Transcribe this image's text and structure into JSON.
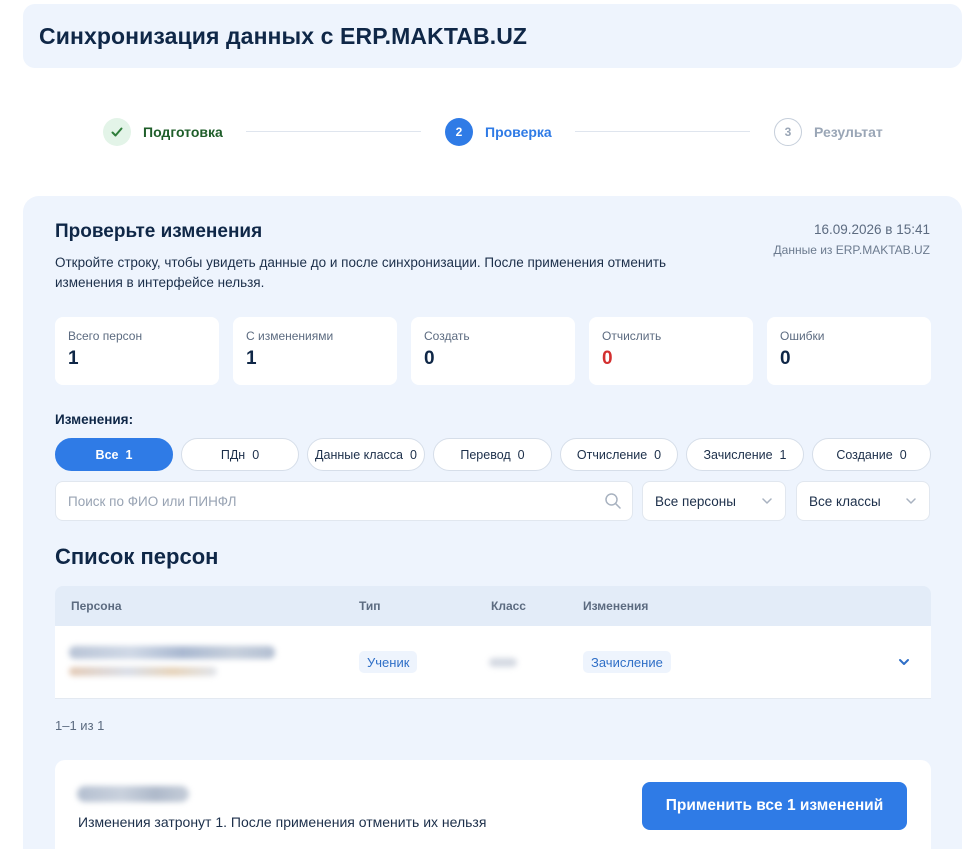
{
  "header": {
    "title": "Синхронизация данных с ERP.MAKTAB.UZ"
  },
  "stepper": {
    "steps": [
      {
        "label": "Подготовка",
        "state": "done",
        "number": ""
      },
      {
        "label": "Проверка",
        "state": "active",
        "number": "2"
      },
      {
        "label": "Результат",
        "state": "todo",
        "number": "3"
      }
    ]
  },
  "review": {
    "title": "Проверьте изменения",
    "description": "Откройте строку, чтобы увидеть данные до и после синхронизации. После применения отменить изменения в интерфейсе нельзя.",
    "timestamp": "16.09.2026 в 15:41",
    "source": "Данные из ERP.MAKTAB.UZ"
  },
  "stats": [
    {
      "label": "Всего персон",
      "value": "1"
    },
    {
      "label": "С изменениями",
      "value": "1"
    },
    {
      "label": "Создать",
      "value": "0"
    },
    {
      "label": "Отчислить",
      "value": "0"
    },
    {
      "label": "Ошибки",
      "value": "0"
    }
  ],
  "filters": {
    "label": "Изменения:",
    "chips": [
      {
        "label": "Все",
        "count": "1"
      },
      {
        "label": "ПДн",
        "count": "0"
      },
      {
        "label": "Данные класса",
        "count": "0"
      },
      {
        "label": "Перевод",
        "count": "0"
      },
      {
        "label": "Отчисление",
        "count": "0"
      },
      {
        "label": "Зачисление",
        "count": "1"
      },
      {
        "label": "Создание",
        "count": "0"
      }
    ],
    "search_placeholder": "Поиск по ФИО или ПИНФЛ",
    "persons_select": "Все персоны",
    "classes_select": "Все классы"
  },
  "list": {
    "title": "Список персон",
    "columns": {
      "person": "Персона",
      "type": "Тип",
      "class": "Класс",
      "changes": "Изменения"
    },
    "rows": [
      {
        "type": "Ученик",
        "change": "Зачисление"
      }
    ],
    "pagination": "1–1 из 1"
  },
  "footer": {
    "note": "Изменения затронут 1. После применения отменить их нельзя",
    "apply_button": "Применить все 1 изменений"
  },
  "colors": {
    "accent": "#2f7be6",
    "success": "#2e7d3a",
    "danger": "#d32f2f",
    "panel": "#eef4fd"
  }
}
